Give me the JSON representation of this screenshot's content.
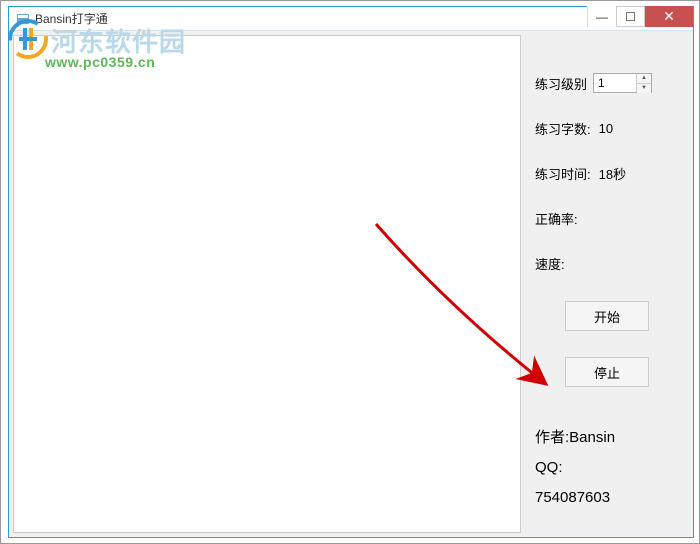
{
  "window": {
    "title": "Bansin打字通"
  },
  "controls": {
    "minimize": "—",
    "maximize": "☐",
    "close": "✕"
  },
  "fields": {
    "level_label": "练习级别",
    "level_value": "1",
    "chars_label": "练习字数:",
    "chars_value": "10",
    "time_label": "练习时间:",
    "time_value": "18秒",
    "accuracy_label": "正确率:",
    "accuracy_value": "",
    "speed_label": "速度:",
    "speed_value": ""
  },
  "buttons": {
    "start": "开始",
    "stop": "停止"
  },
  "author": {
    "line1": "作者:Bansin",
    "line2": "QQ:",
    "line3": "754087603"
  },
  "watermark": {
    "site_name": "河东软件园",
    "site_url": "www.pc0359.cn"
  }
}
